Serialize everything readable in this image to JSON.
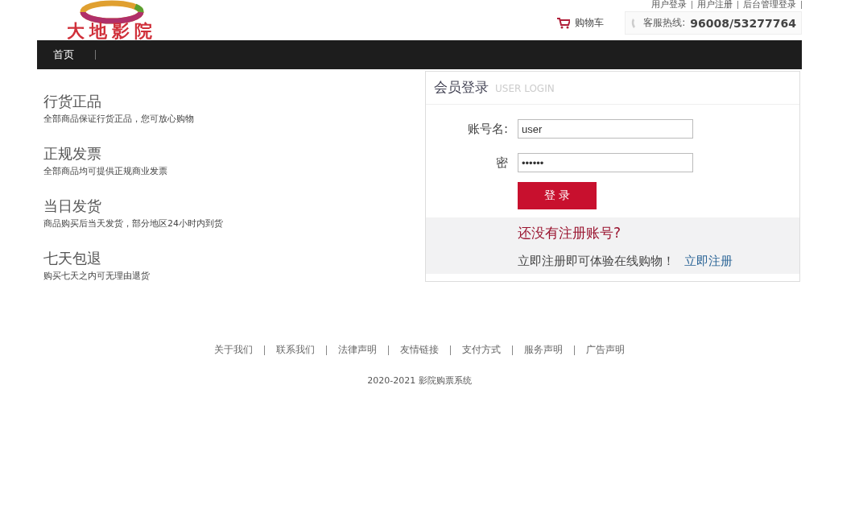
{
  "logo": {
    "text": "大地影院"
  },
  "top_links": [
    "用户登录",
    "用户注册",
    "后台管理登录"
  ],
  "cart": {
    "label": "购物车"
  },
  "hotline": {
    "label": "客服热线:",
    "number": "96008/53277764"
  },
  "nav": [
    {
      "label": "首页",
      "selected": true
    }
  ],
  "features": [
    {
      "title": "行货正品",
      "text": "全部商品保证行货正品，您可放心购物"
    },
    {
      "title": "正规发票",
      "text": "全部商品均可提供正规商业发票"
    },
    {
      "title": "当日发货",
      "text": "商品购买后当天发货，部分地区24小时内到货"
    },
    {
      "title": "七天包退",
      "text": "购买七天之内可无理由退货"
    }
  ],
  "login": {
    "title": "会员登录",
    "subtitle": "USER LOGIN",
    "fields": [
      {
        "label": "账号名:",
        "value": "user"
      },
      {
        "label": "密",
        "value": "••••••"
      }
    ],
    "button": "登 录",
    "register_question": "还没有注册账号?",
    "register_text": "立即注册即可体验在线购物！",
    "register_link": "立即注册"
  },
  "footer_links": [
    "关于我们",
    "联系我们",
    "法律声明",
    "友情链接",
    "支付方式",
    "服务声明",
    "广告声明"
  ],
  "copyright": "2020-2021 影院购票系统"
}
